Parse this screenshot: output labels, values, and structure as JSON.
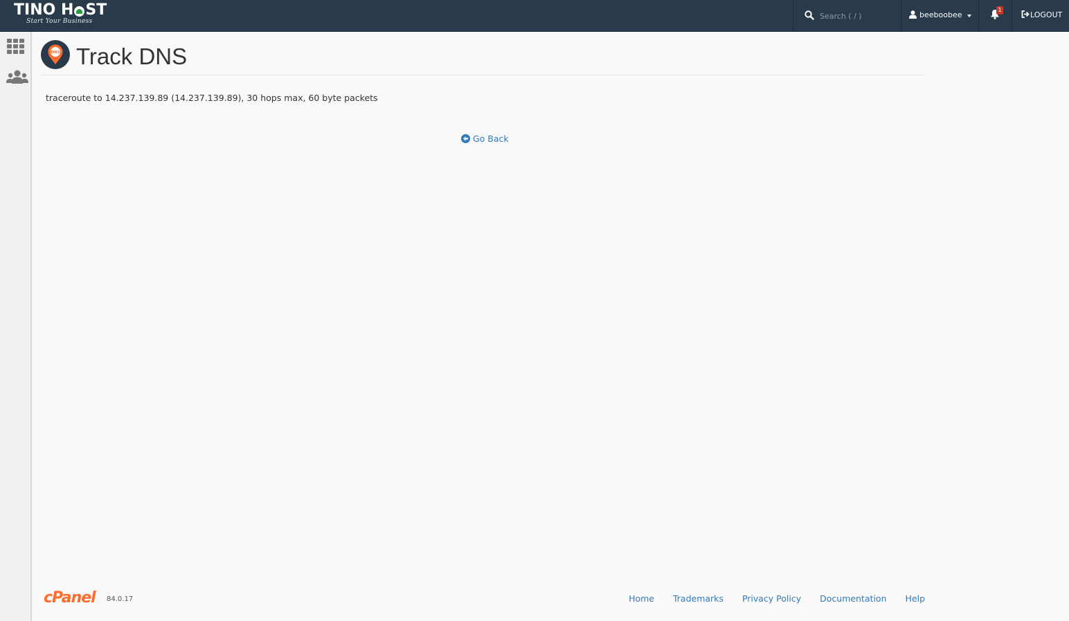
{
  "header": {
    "logo_text_left": "TINO H",
    "logo_text_right": "ST",
    "logo_tagline": "Start Your Business",
    "search_placeholder": "Search ( / )",
    "username": "beeboobee",
    "notification_count": "1",
    "logout_label": "LOGOUT"
  },
  "sidebar": {
    "items": [
      {
        "icon": "apps-grid-icon"
      },
      {
        "icon": "users-group-icon"
      }
    ]
  },
  "page": {
    "title": "Track DNS",
    "icon": "dns-pin-icon",
    "output_line": "traceroute to 14.237.139.89 (14.237.139.89), 30 hops max, 60 byte packets",
    "go_back_label": "Go Back"
  },
  "footer": {
    "brand": "cPanel",
    "version": "84.0.17",
    "links": [
      "Home",
      "Trademarks",
      "Privacy Policy",
      "Documentation",
      "Help"
    ]
  },
  "colors": {
    "topbar": "#293a4a",
    "accent_orange": "#ff6c2c",
    "link_blue": "#337ab7"
  }
}
